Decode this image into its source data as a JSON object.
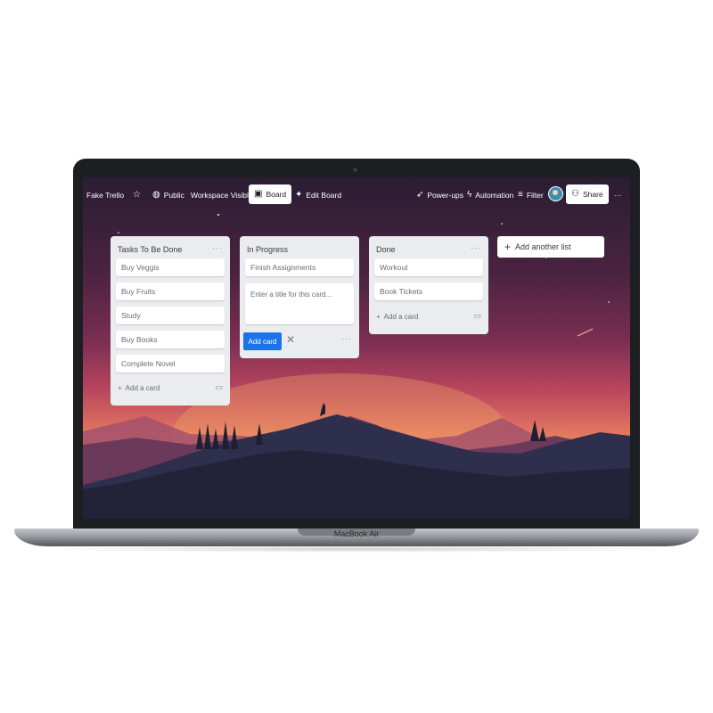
{
  "device": {
    "label": "MacBook Air"
  },
  "topbar": {
    "board_name": "Fake Trello",
    "star_icon": "star-icon",
    "visibility": "Public",
    "workspace": "Workspace Visible",
    "board_view": "Board",
    "edit_board": "Edit Board",
    "powerups": "Power-ups",
    "automation": "Automation",
    "filter": "Filter",
    "share": "Share",
    "more": "···"
  },
  "lists": [
    {
      "title": "Tasks To Be Done",
      "more": "···",
      "cards": [
        "Buy Veggis",
        "Buy Fruits",
        "Study",
        "Buy Books",
        "Complete Novel"
      ],
      "add_card": "Add a card"
    },
    {
      "title": "In Progress",
      "more": "···",
      "cards": [
        "Finish Assignments"
      ],
      "composer_placeholder": "Enter a title for this card...",
      "add_button": "Add card"
    },
    {
      "title": "Done",
      "more": "···",
      "cards": [
        "Workout",
        "Book Tickets"
      ],
      "add_card": "Add a card"
    }
  ],
  "add_list": "Add another list",
  "colors": {
    "accent": "#1a73e8",
    "list_bg": "#ebecf0",
    "topbar_text": "#ffffff"
  }
}
